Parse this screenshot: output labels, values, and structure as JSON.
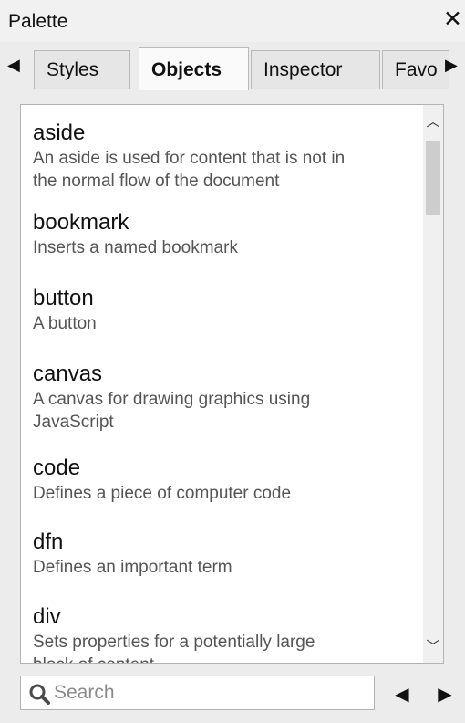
{
  "window": {
    "title": "Palette",
    "close_icon": "close-icon"
  },
  "tabs": [
    {
      "label": "Styles",
      "active": false
    },
    {
      "label": "Objects",
      "active": true
    },
    {
      "label": "Inspector",
      "active": false
    },
    {
      "label": "Favo",
      "active": false
    }
  ],
  "items": [
    {
      "name": "aside",
      "desc_lines": [
        "An aside is used for content that is not in",
        "the normal flow of the document"
      ]
    },
    {
      "name": "bookmark",
      "desc_lines": [
        "Inserts a named bookmark"
      ]
    },
    {
      "name": "button",
      "desc_lines": [
        "A button"
      ]
    },
    {
      "name": "canvas",
      "desc_lines": [
        "A canvas for drawing graphics using",
        "JavaScript"
      ]
    },
    {
      "name": "code",
      "desc_lines": [
        "Defines a piece of computer code"
      ]
    },
    {
      "name": "dfn",
      "desc_lines": [
        "Defines an important term"
      ]
    },
    {
      "name": "div",
      "desc_lines": [
        "Sets properties for a potentially large",
        "block of content"
      ]
    }
  ],
  "search": {
    "placeholder": "Search",
    "value": ""
  },
  "icons": {
    "tab_prev": "triangle-left-icon",
    "tab_next": "triangle-right-icon",
    "scroll_up": "chevron-up-icon",
    "scroll_down": "chevron-down-icon",
    "search": "magnifier-icon",
    "nav_prev": "triangle-left-icon",
    "nav_next": "triangle-right-icon"
  }
}
